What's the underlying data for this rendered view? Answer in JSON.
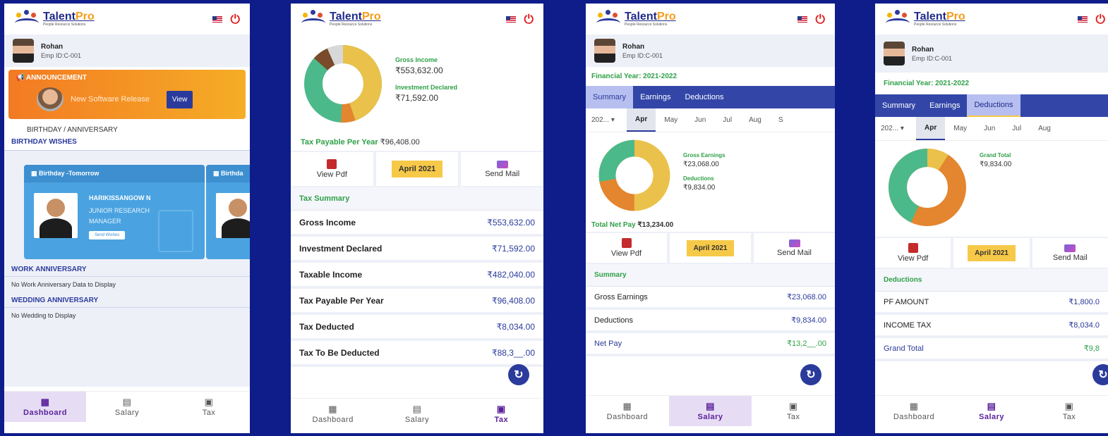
{
  "brand": {
    "name_a": "Talent",
    "name_b": "Pro",
    "sup": "°",
    "tagline": "People Resource Solutions"
  },
  "profile": {
    "name": "Rohan",
    "emp_id": "Emp ID:C-001"
  },
  "nav": {
    "dashboard": "Dashboard",
    "salary": "Salary",
    "tax": "Tax"
  },
  "colors": {
    "background": "#0e1d8a",
    "accent": "#3346a8",
    "green": "#2fa048",
    "yellow": "#f7c948"
  },
  "dashboard": {
    "announcement_title": "ANNOUNCEMENT",
    "announcement_text": "New Software Release",
    "view_label": "View",
    "birthday_anniversary": "BIRTHDAY / ANNIVERSARY",
    "birthday_wishes": "BIRTHDAY WISHES",
    "card_title": "Birthday -Tomorrow",
    "card2_title": "Birthda",
    "person_name": "HARIKISSANGOW N",
    "person_role": "JUNIOR RESEARCH MANAGER",
    "send_wishes": "Send Wishes",
    "work_anniversary": "WORK ANNIVERSARY",
    "work_empty": "No Work Anniversary Data to Display",
    "wedding_anniversary": "WEDDING ANNIVERSARY",
    "wedding_empty": "No Wedding to Display"
  },
  "tax": {
    "gross_income_label": "Gross Income",
    "gross_income_value": "₹553,632.00",
    "investment_label": "Investment Declared",
    "investment_value": "₹71,592.00",
    "tax_payable_headline": "Tax Payable Per Year",
    "tax_payable_value": "₹96,408.00",
    "view_pdf": "View Pdf",
    "month": "April 2021",
    "send_mail": "Send Mail",
    "summary_title": "Tax Summary",
    "rows": [
      {
        "label": "Gross Income",
        "value": "₹553,632.00"
      },
      {
        "label": "Investment Declared",
        "value": "₹71,592.00"
      },
      {
        "label": "Taxable Income",
        "value": "₹482,040.00"
      },
      {
        "label": "Tax Payable Per Year",
        "value": "₹96,408.00"
      },
      {
        "label": "Tax Deducted",
        "value": "₹8,034.00"
      },
      {
        "label": "Tax To Be Deducted",
        "value": "₹88,3__.00"
      }
    ]
  },
  "salary_summary": {
    "financial_year": "Financial Year: 2021-2022",
    "tabs": [
      "Summary",
      "Earnings",
      "Deductions"
    ],
    "year_select": "202...",
    "months": [
      "Apr",
      "May",
      "Jun",
      "Jul",
      "Aug",
      "S"
    ],
    "gross_earnings_label": "Gross Earnings",
    "gross_earnings_value": "₹23,068.00",
    "deductions_label": "Deductions",
    "deductions_value": "₹9,834.00",
    "net_pay_headline": "Total Net Pay",
    "net_pay_value": "₹13,234.00",
    "view_pdf": "View Pdf",
    "month": "April 2021",
    "send_mail": "Send Mail",
    "summary_title": "Summary",
    "rows": [
      {
        "label": "Gross Earnings",
        "value": "₹23,068.00"
      },
      {
        "label": "Deductions",
        "value": "₹9,834.00"
      },
      {
        "label": "Net Pay",
        "value": "₹13,2__.00"
      }
    ]
  },
  "salary_deductions": {
    "financial_year": "Financial Year: 2021-2022",
    "tabs": [
      "Summary",
      "Earnings",
      "Deductions"
    ],
    "year_select": "202...",
    "months": [
      "Apr",
      "May",
      "Jun",
      "Jul",
      "Aug"
    ],
    "grand_total_label": "Grand Total",
    "grand_total_value": "₹9,834.00",
    "view_pdf": "View Pdf",
    "month": "April 2021",
    "send_mail": "Send Mail",
    "section_title": "Deductions",
    "rows": [
      {
        "label": "PF AMOUNT",
        "value": "₹1,800.0"
      },
      {
        "label": "INCOME TAX",
        "value": "₹8,034.0"
      },
      {
        "label": "Grand Total",
        "value": "₹9,8"
      }
    ]
  }
}
